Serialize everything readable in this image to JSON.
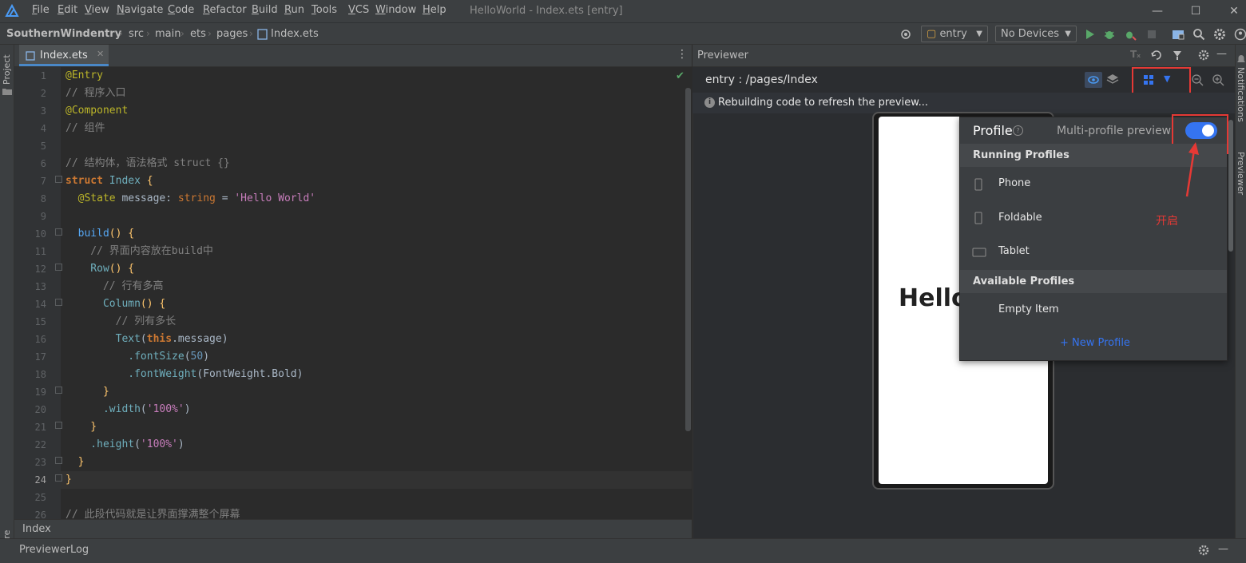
{
  "menubar": {
    "items": [
      {
        "u": "F",
        "rest": "ile"
      },
      {
        "u": "E",
        "rest": "dit"
      },
      {
        "u": "V",
        "rest": "iew"
      },
      {
        "u": "N",
        "rest": "avigate"
      },
      {
        "u": "C",
        "rest": "ode"
      },
      {
        "u": "R",
        "rest": "efactor"
      },
      {
        "u": "B",
        "rest": "uild"
      },
      {
        "u": "R",
        "rest": "un"
      },
      {
        "u": "T",
        "rest": "ools"
      },
      {
        "u": "V",
        "rest": "CS"
      },
      {
        "u": "W",
        "rest": "indow"
      },
      {
        "u": "H",
        "rest": "elp"
      }
    ],
    "title": "HelloWorld - Index.ets [entry]"
  },
  "breadcrumb": [
    "SouthernWind",
    "entry",
    "src",
    "main",
    "ets",
    "pages",
    "Index.ets"
  ],
  "toolbar": {
    "module": "entry",
    "device": "No Devices"
  },
  "left_strip": {
    "project": "Project",
    "structure": "ucture"
  },
  "right_strip": {
    "notifications": "Notifications",
    "previewer": "Previewer"
  },
  "editor": {
    "tab": "Index.ets",
    "status": "Index",
    "current_line": 24,
    "lines": [
      {
        "n": "1"
      },
      {
        "n": "2"
      },
      {
        "n": "3"
      },
      {
        "n": "4"
      },
      {
        "n": "5"
      },
      {
        "n": "6"
      },
      {
        "n": "7"
      },
      {
        "n": "8"
      },
      {
        "n": "9"
      },
      {
        "n": "10"
      },
      {
        "n": "11"
      },
      {
        "n": "12"
      },
      {
        "n": "13"
      },
      {
        "n": "14"
      },
      {
        "n": "15"
      },
      {
        "n": "16"
      },
      {
        "n": "17"
      },
      {
        "n": "18"
      },
      {
        "n": "19"
      },
      {
        "n": "20"
      },
      {
        "n": "21"
      },
      {
        "n": "22"
      },
      {
        "n": "23"
      },
      {
        "n": "24"
      },
      {
        "n": "25"
      },
      {
        "n": "26"
      }
    ],
    "tokens": {
      "l1": "@Entry",
      "l2": "// 程序入口",
      "l3": "@Component",
      "l4": "// 组件",
      "l6": "// 结构体，语法格式 struct {}",
      "l7a": "struct",
      "l7b": " Index ",
      "l7c": "{",
      "l8a": "  @State",
      "l8b": " message: ",
      "l8c": "string",
      "l8d": " = ",
      "l8e": "'Hello World'",
      "l10a": "  build",
      "l10b": "() {",
      "l11": "    // 界面内容放在build中",
      "l12a": "    Row",
      "l12b": "() {",
      "l13": "      // 行有多高",
      "l14a": "      Column",
      "l14b": "() {",
      "l15": "        // 列有多长",
      "l16a": "        Text",
      "l16b": "(",
      "l16c": "this",
      "l16d": ".message",
      "l16e": ")",
      "l17a": "          .fontSize",
      "l17b": "(",
      "l17c": "50",
      "l17d": ")",
      "l18a": "          .fontWeight",
      "l18b": "(FontWeight.Bold)",
      "l19": "      }",
      "l20a": "      .width",
      "l20b": "(",
      "l20c": "'100%'",
      "l20d": ")",
      "l21": "    }",
      "l22a": "    .height",
      "l22b": "(",
      "l22c": "'100%'",
      "l22d": ")",
      "l23": "  }",
      "l24": "}",
      "l26": "// 此段代码就是让界面撑满整个屏幕"
    }
  },
  "previewer": {
    "title": "Previewer",
    "path": "entry : /pages/Index",
    "rebuilding": "Rebuilding code to refresh the preview...",
    "screen_text": "Hello",
    "profile_popup": {
      "title": "Profile",
      "multi_label": "Multi-profile preview",
      "multi_enabled": true,
      "running_header": "Running Profiles",
      "running": [
        "Phone",
        "Foldable",
        "Tablet"
      ],
      "available_header": "Available Profiles",
      "available": [
        "Empty Item"
      ],
      "new_profile": "+ New Profile"
    },
    "annotation": "开启"
  },
  "bottom": {
    "previewer_log": "PreviewerLog"
  },
  "colors": {
    "accent": "#3574f0",
    "annotation_red": "#e53935",
    "run_green": "#59a869"
  }
}
